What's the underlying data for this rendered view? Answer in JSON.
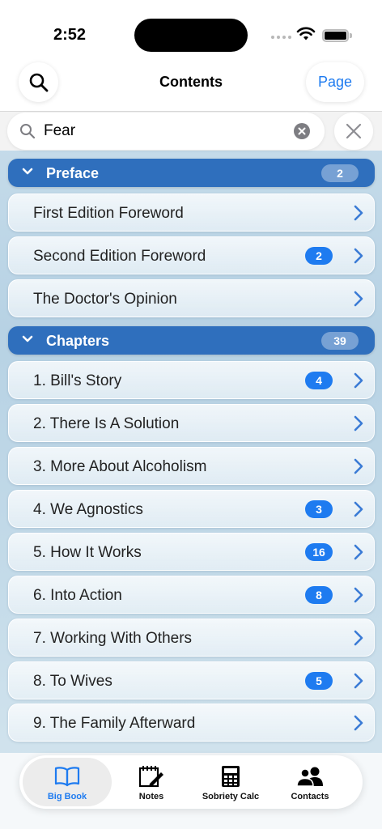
{
  "status_bar": {
    "time": "2:52"
  },
  "nav": {
    "title": "Contents",
    "page_button": "Page"
  },
  "search": {
    "query": "Fear"
  },
  "sections": [
    {
      "title": "Preface",
      "count": "2",
      "items": [
        {
          "label": "First Edition Foreword",
          "badge": ""
        },
        {
          "label": "Second Edition Foreword",
          "badge": "2"
        },
        {
          "label": "The Doctor's Opinion",
          "badge": ""
        }
      ]
    },
    {
      "title": "Chapters",
      "count": "39",
      "items": [
        {
          "label": "1. Bill's Story",
          "badge": "4"
        },
        {
          "label": "2. There Is A Solution",
          "badge": ""
        },
        {
          "label": "3. More About Alcoholism",
          "badge": ""
        },
        {
          "label": "4. We Agnostics",
          "badge": "3"
        },
        {
          "label": "5. How It Works",
          "badge": "16"
        },
        {
          "label": "6. Into Action",
          "badge": "8"
        },
        {
          "label": "7. Working With Others",
          "badge": ""
        },
        {
          "label": "8. To Wives",
          "badge": "5"
        },
        {
          "label": "9. The Family Afterward",
          "badge": ""
        }
      ]
    }
  ],
  "tabs": [
    {
      "label": "Big Book",
      "icon": "book-icon",
      "active": true
    },
    {
      "label": "Notes",
      "icon": "notes-icon",
      "active": false
    },
    {
      "label": "Sobriety Calc",
      "icon": "calculator-icon",
      "active": false
    },
    {
      "label": "Contacts",
      "icon": "contacts-icon",
      "active": false
    }
  ],
  "colors": {
    "accent": "#1e7bf0",
    "section_header": "#2f6fbd"
  }
}
